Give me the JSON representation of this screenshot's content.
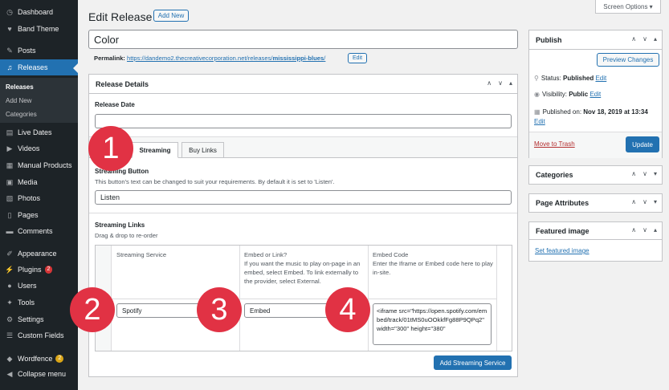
{
  "sidebar": {
    "items": [
      {
        "label": "Dashboard",
        "icon": "dashboard-icon",
        "glyph": "◷"
      },
      {
        "label": "Band Theme",
        "icon": "heart-icon",
        "glyph": "♥"
      },
      {
        "label": "Posts",
        "icon": "pin-icon",
        "glyph": "✎"
      },
      {
        "label": "Releases",
        "icon": "music-icon",
        "glyph": "♫"
      },
      {
        "label": "Live Dates",
        "icon": "calendar-icon",
        "glyph": "▤"
      },
      {
        "label": "Videos",
        "icon": "video-icon",
        "glyph": "▶"
      },
      {
        "label": "Manual Products",
        "icon": "products-icon",
        "glyph": "▦"
      },
      {
        "label": "Media",
        "icon": "media-icon",
        "glyph": "▣"
      },
      {
        "label": "Photos",
        "icon": "photos-icon",
        "glyph": "▧"
      },
      {
        "label": "Pages",
        "icon": "pages-icon",
        "glyph": "▯"
      },
      {
        "label": "Comments",
        "icon": "comments-icon",
        "glyph": "▬"
      },
      {
        "label": "Appearance",
        "icon": "appearance-icon",
        "glyph": "✐"
      },
      {
        "label": "Plugins",
        "icon": "plugins-icon",
        "glyph": "⚡",
        "badge": "2"
      },
      {
        "label": "Users",
        "icon": "users-icon",
        "glyph": "●"
      },
      {
        "label": "Tools",
        "icon": "tools-icon",
        "glyph": "✦"
      },
      {
        "label": "Settings",
        "icon": "settings-icon",
        "glyph": "⚙"
      },
      {
        "label": "Custom Fields",
        "icon": "custom-fields-icon",
        "glyph": "☰"
      },
      {
        "label": "Wordfence",
        "icon": "wordfence-icon",
        "glyph": "◆",
        "badge": "2"
      },
      {
        "label": "Collapse menu",
        "icon": "collapse-icon",
        "glyph": "◀"
      }
    ],
    "submenu": [
      "Releases",
      "Add New",
      "Categories"
    ]
  },
  "header": {
    "title": "Edit Release",
    "add_new": "Add New",
    "screen_options": "Screen Options ▾"
  },
  "post": {
    "title_value": "Color",
    "permalink_label": "Permalink:",
    "permalink_url": "https://dandemo2.thecreativecorporation.net/releases/",
    "permalink_slug": "mississippi-blues",
    "permalink_end": "/",
    "permalink_edit": "Edit"
  },
  "release_details": {
    "heading": "Release Details",
    "release_date_label": "Release Date",
    "release_date_value": "",
    "tabs": [
      "Streaming",
      "Buy Links"
    ],
    "streaming_button_label": "Streaming Button",
    "streaming_button_help": "This button's text can be changed to suit your requirements. By default it is set to 'Listen'.",
    "streaming_button_value": "Listen",
    "streaming_links_label": "Streaming Links",
    "streaming_links_help": "Drag & drop to re-order",
    "table_headers": {
      "service": "Streaming Service",
      "embed_title": "Embed or Link?",
      "embed_desc": "If you want the music to play on-page in an embed, select Embed. To link externally to the provider, select External.",
      "code_title": "Embed Code",
      "code_desc": "Enter the Iframe or Embed code here to play in-site."
    },
    "row": {
      "service": "Spotify",
      "embed": "Embed",
      "code": "<iframe src=\"https://open.spotify.com/embed/track/01tMS0uOOkkfFg88P9QPq2\" width=\"300\" height=\"380\""
    },
    "add_button": "Add Streaming Service"
  },
  "publish": {
    "heading": "Publish",
    "preview": "Preview Changes",
    "status_label": "Status: ",
    "status_value": "Published",
    "visibility_label": "Visibility: ",
    "visibility_value": "Public",
    "published_label": "Published on: ",
    "published_value": "Nov 18, 2019 at 13:34",
    "edit": "Edit",
    "trash": "Move to Trash",
    "update": "Update"
  },
  "panels": {
    "categories": "Categories",
    "page_attributes": "Page Attributes",
    "featured_image": "Featured image",
    "set_featured": "Set featured image"
  },
  "callouts": [
    "1",
    "2",
    "3",
    "4"
  ],
  "controls": {
    "up": "∧",
    "down": "∨",
    "toggle": "▴",
    "toggle_down": "▾"
  }
}
